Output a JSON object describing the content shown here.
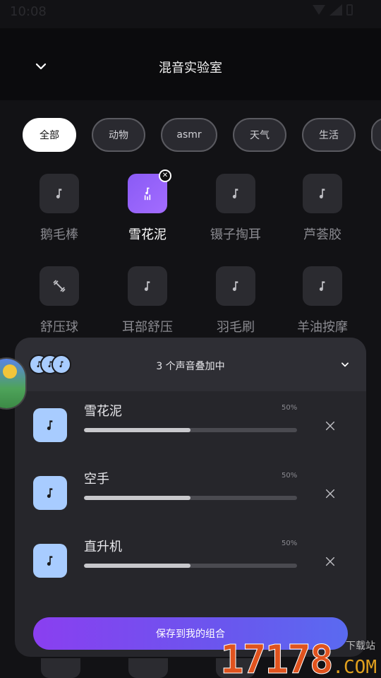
{
  "status": {
    "time": "10:08"
  },
  "header": {
    "title": "混音实验室"
  },
  "categories": [
    {
      "label": "全部",
      "active": true
    },
    {
      "label": "动物",
      "active": false
    },
    {
      "label": "asmr",
      "active": false
    },
    {
      "label": "天气",
      "active": false
    },
    {
      "label": "生活",
      "active": false
    },
    {
      "label": "",
      "active": false
    }
  ],
  "sounds": [
    {
      "label": "鹅毛棒",
      "icon": "music-note-icon",
      "selected": false
    },
    {
      "label": "雪花泥",
      "icon": "music-note-bars-icon",
      "selected": true
    },
    {
      "label": "镊子掏耳",
      "icon": "music-note-icon",
      "selected": false
    },
    {
      "label": "芦荟胶",
      "icon": "music-note-icon",
      "selected": false
    },
    {
      "label": "舒压球",
      "icon": "dumbbell-icon",
      "selected": false
    },
    {
      "label": "耳部舒压",
      "icon": "music-note-icon",
      "selected": false
    },
    {
      "label": "羽毛刷",
      "icon": "music-note-icon",
      "selected": false
    },
    {
      "label": "羊油按摩",
      "icon": "music-note-icon",
      "selected": false
    }
  ],
  "mixer": {
    "title": "3 个声音叠加中",
    "tracks": [
      {
        "name": "雪花泥",
        "volume_label": "50%",
        "volume": 0.5
      },
      {
        "name": "空手",
        "volume_label": "50%",
        "volume": 0.5
      },
      {
        "name": "直升机",
        "volume_label": "50%",
        "volume": 0.5
      }
    ],
    "save_label": "保存到我的组合"
  },
  "watermark": {
    "number": "17178",
    "download": "下载站",
    "domain": ".COM"
  },
  "colors": {
    "accent": "#8a5bf5",
    "track_icon_bg": "#a8ccff",
    "panel_bg": "#26262b"
  }
}
